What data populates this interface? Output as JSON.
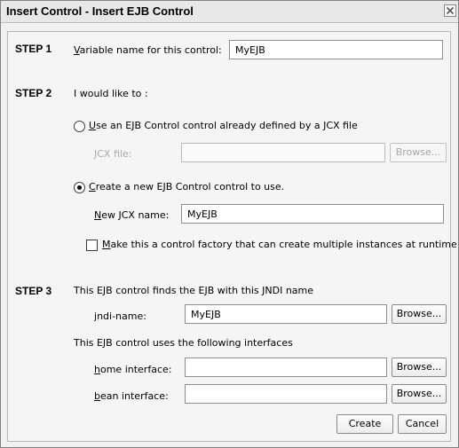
{
  "window": {
    "title": "Insert Control - Insert EJB Control"
  },
  "step1": {
    "label": "STEP 1",
    "var_label_mnemonic": "V",
    "var_label_rest": "ariable name for this control:",
    "var_value": "MyEJB"
  },
  "step2": {
    "label": "STEP 2",
    "intro": "I would like to :",
    "option_existing": {
      "mnemonic": "U",
      "rest": "se an EJB Control control already defined by a JCX file",
      "selected": false
    },
    "jcx_file_label": "JCX file:",
    "jcx_file_value": "",
    "browse_disabled_label": "Browse...",
    "option_new": {
      "mnemonic": "C",
      "rest": "reate a new EJB Control control to use.",
      "selected": true
    },
    "new_jcx_mnemonic": "N",
    "new_jcx_rest": "ew JCX name:",
    "new_jcx_value": "MyEJB",
    "factory_check": {
      "mnemonic": "M",
      "rest": "ake this a control factory that can create multiple instances at runtime",
      "checked": false
    }
  },
  "step3": {
    "label": "STEP 3",
    "jndi_intro": "This EJB control finds the EJB with this JNDI name",
    "jndi_mnemonic": "j",
    "jndi_rest": "ndi-name:",
    "jndi_value": "MyEJB",
    "interfaces_intro": "This EJB control uses the following interfaces",
    "home_mnemonic": "h",
    "home_rest": "ome interface:",
    "home_value": "",
    "bean_mnemonic": "b",
    "bean_rest": "ean interface:",
    "bean_value": "",
    "browse_label": "Browse..."
  },
  "footer": {
    "create_label": "Create",
    "cancel_label": "Cancel"
  }
}
